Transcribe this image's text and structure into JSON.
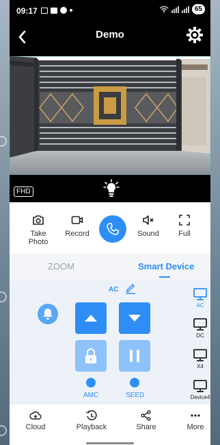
{
  "status_bar": {
    "time": "09:17",
    "battery": "65"
  },
  "header": {
    "title": "Demo"
  },
  "video": {
    "quality_badge": "FHD"
  },
  "controls": {
    "take_photo": "Take Photo",
    "record": "Record",
    "sound": "Sound",
    "full": "Full"
  },
  "tabs": {
    "zoom": "ZOOM",
    "smart_device": "Smart Device"
  },
  "smart_panel": {
    "current_device": "AC",
    "indicators": [
      "AMC",
      "SEED"
    ],
    "devices": [
      "AC",
      "DC",
      "X4",
      "Device4"
    ],
    "selected_device": "AC"
  },
  "bottom_nav": {
    "cloud": "Cloud",
    "playback": "Playback",
    "share": "Share",
    "more": "More"
  },
  "colors": {
    "accent": "#2f8ef6",
    "accent_light": "#8ec2fb",
    "panel_bg": "#edf2f8"
  }
}
